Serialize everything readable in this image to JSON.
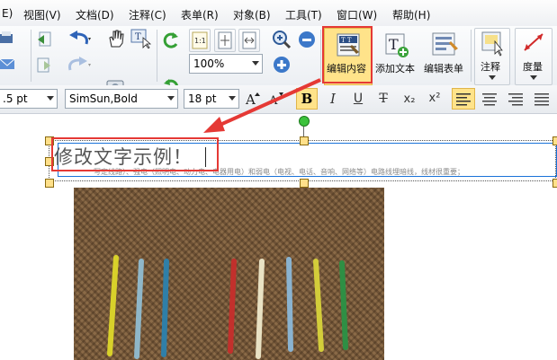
{
  "menu": [
    "E)",
    "视图(V)",
    "文档(D)",
    "注释(C)",
    "表单(R)",
    "对象(B)",
    "工具(T)",
    "窗口(W)",
    "帮助(H)"
  ],
  "toolbar": {
    "zoom_value": "100%",
    "edit_content_label": "编辑内容",
    "add_text_label": "添加文本",
    "edit_form_label": "编辑表单",
    "annotate_label": "注释",
    "measure_label": "度量"
  },
  "format_bar": {
    "line_width": ".5 pt",
    "font_name": "SimSun,Bold",
    "font_size": "18 pt",
    "bold": "B",
    "italic": "I",
    "underline": "U",
    "strike": "T",
    "subscript": "x₂",
    "superscript": "x²"
  },
  "document": {
    "edited_text": "修改文字示例！",
    "bg_paragraph": "写定线路）、强电（照明电、动力电、电器用电）和弱电（电视、电话、音响、网络等）电路线埋暗线，线材很重要；"
  },
  "colors": {
    "accent_red": "#e53935",
    "highlight": "#ffe38a",
    "selection_blue": "#1a73d9"
  }
}
